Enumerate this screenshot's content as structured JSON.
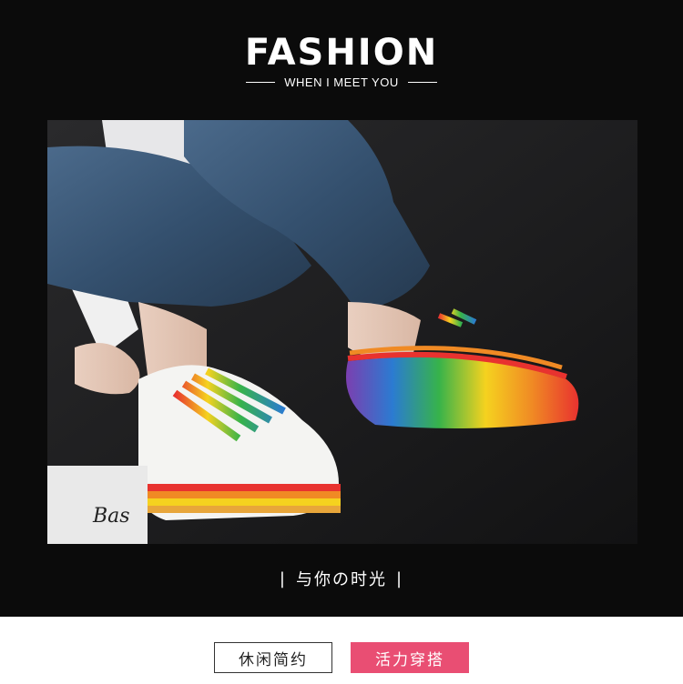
{
  "header": {
    "title": "FASHION",
    "subtitle": "WHEN I MEET YOU"
  },
  "photo": {
    "book_text": "Bas"
  },
  "tagline": {
    "left_bar": "|",
    "text": "与你の时光",
    "right_bar": "|"
  },
  "tags": {
    "casual": "休闲简约",
    "vibrant": "活力穿搭"
  },
  "colors": {
    "banner_bg": "#0b0b0b",
    "accent_pink": "#e94e73",
    "denim": "#3a5675",
    "rainbow": [
      "#e8322f",
      "#f08a24",
      "#f5d21f",
      "#37b34a",
      "#2b7bd1",
      "#7b3fb0"
    ]
  }
}
